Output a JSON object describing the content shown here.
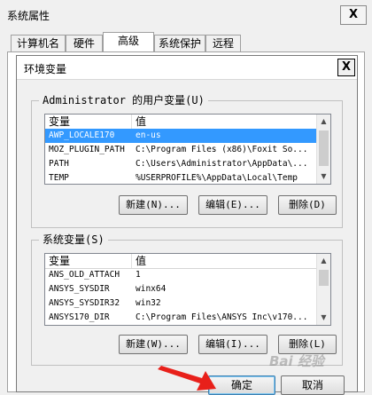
{
  "outer_window": {
    "title": "系统属性",
    "close_label": "X",
    "tabs": [
      {
        "label": "计算机名"
      },
      {
        "label": "硬件"
      },
      {
        "label": "高级"
      },
      {
        "label": "系统保护"
      },
      {
        "label": "远程"
      }
    ],
    "active_tab": "高级"
  },
  "dialog": {
    "title": "环境变量",
    "close_label": "X",
    "user_vars": {
      "legend": "Administrator 的用户变量(U)",
      "columns": [
        "变量",
        "值"
      ],
      "rows": [
        {
          "name": "AWP_LOCALE170",
          "value": "en-us",
          "selected": true
        },
        {
          "name": "MOZ_PLUGIN_PATH",
          "value": "C:\\Program Files (x86)\\Foxit So..."
        },
        {
          "name": "PATH",
          "value": "C:\\Users\\Administrator\\AppData\\..."
        },
        {
          "name": "TEMP",
          "value": "%USERPROFILE%\\AppData\\Local\\Temp"
        }
      ],
      "buttons": {
        "new": "新建(N)...",
        "edit": "编辑(E)...",
        "delete": "删除(D)"
      }
    },
    "system_vars": {
      "legend": "系统变量(S)",
      "columns": [
        "变量",
        "值"
      ],
      "rows": [
        {
          "name": "ANS_OLD_ATTACH",
          "value": "1"
        },
        {
          "name": "ANSYS_SYSDIR",
          "value": "winx64"
        },
        {
          "name": "ANSYS_SYSDIR32",
          "value": "win32"
        },
        {
          "name": "ANSYS170_DIR",
          "value": "C:\\Program Files\\ANSYS Inc\\v170..."
        }
      ],
      "buttons": {
        "new": "新建(W)...",
        "edit": "编辑(I)...",
        "delete": "删除(L)"
      }
    },
    "ok_label": "确定",
    "cancel_label": "取消"
  },
  "annotation": {
    "arrow_color": "#e8201a"
  },
  "watermark": "Bai 经验"
}
